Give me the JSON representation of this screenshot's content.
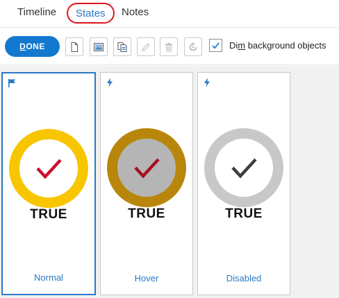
{
  "tabs": [
    {
      "label": "Timeline"
    },
    {
      "label": "States",
      "active": true
    },
    {
      "label": "Notes"
    }
  ],
  "toolbar": {
    "done_label_underlined": "D",
    "done_label_rest": "ONE",
    "buttons": [
      "new-state-icon",
      "image-icon",
      "duplicate-icon",
      "edit-icon",
      "delete-icon",
      "reset-icon"
    ],
    "dim_checked": true,
    "dim_label_pre": "Di",
    "dim_label_underlined": "m",
    "dim_label_post": " background objects"
  },
  "states": [
    {
      "label": "Normal",
      "value": "TRUE",
      "icon": "flag-icon",
      "ring_color": "#f7c600",
      "inner_color": "#ffffff",
      "check_color": "#c8102e",
      "selected": true
    },
    {
      "label": "Hover",
      "value": "TRUE",
      "icon": "lightning-icon",
      "ring_color": "#b8860b",
      "inner_color": "#b5b5b5",
      "check_color": "#a50f1d",
      "selected": false
    },
    {
      "label": "Disabled",
      "value": "TRUE",
      "icon": "lightning-icon",
      "ring_color": "#c8c8c8",
      "inner_color": "#ffffff",
      "check_color": "#3d3d3d",
      "selected": false
    }
  ],
  "colors": {
    "accent": "#1379cf",
    "tab_highlight": "#e0141e"
  }
}
